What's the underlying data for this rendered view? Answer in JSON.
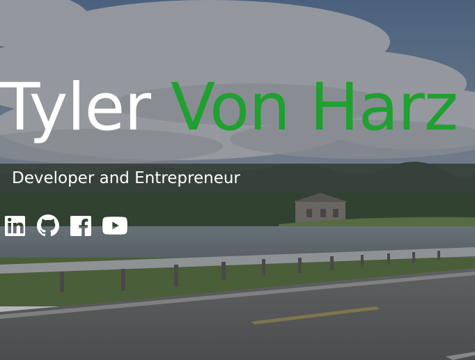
{
  "hero": {
    "first_name": "Tyler",
    "last_name": "Von Harz",
    "tagline": "Developer and Entrepreneur"
  },
  "social": [
    {
      "icon": "linkedin-icon",
      "network": "LinkedIn"
    },
    {
      "icon": "github-icon",
      "network": "GitHub"
    },
    {
      "icon": "facebook-icon",
      "network": "Facebook"
    },
    {
      "icon": "youtube-icon",
      "network": "YouTube"
    }
  ],
  "colors": {
    "first_name": "#ffffff",
    "last_name_accent": "#1fa030",
    "text": "#ffffff"
  }
}
